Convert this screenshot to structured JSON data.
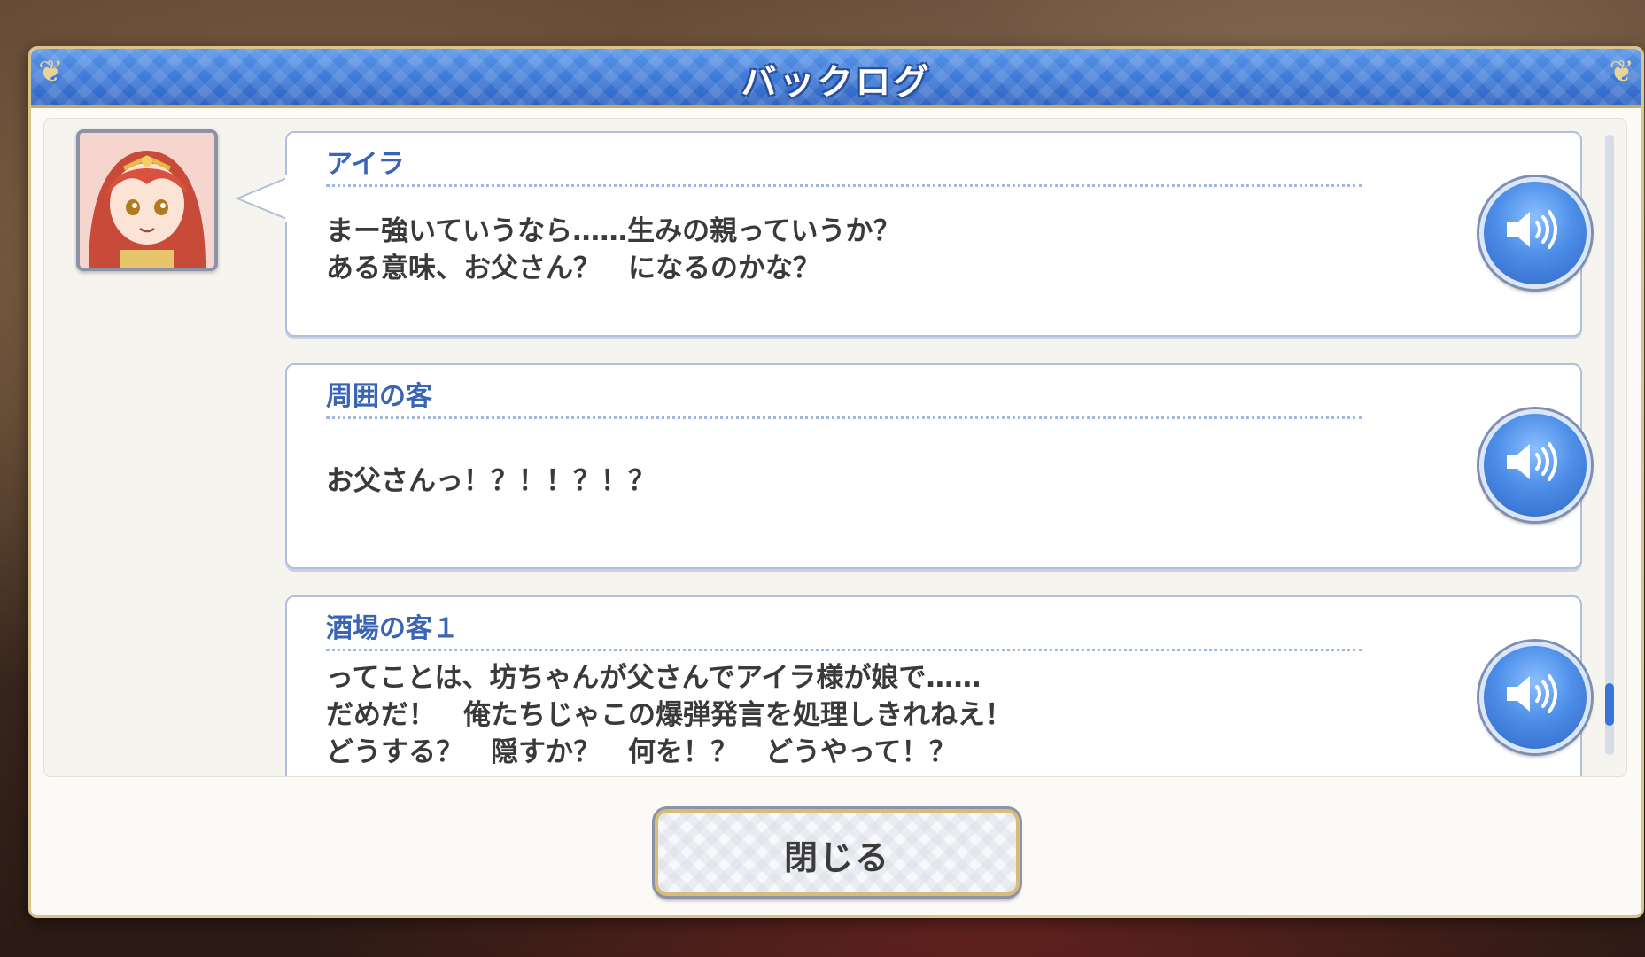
{
  "window": {
    "title": "バックログ"
  },
  "log": {
    "entries": [
      {
        "speaker": "アイラ",
        "text": "まー強いていうなら……生みの親っていうか？\nある意味、お父さん？　になるのかな？",
        "has_portrait": true
      },
      {
        "speaker": "周囲の客",
        "text": "お父さんっ！？！！？！？",
        "has_portrait": false
      },
      {
        "speaker": "酒場の客１",
        "text": "ってことは、坊ちゃんが父さんでアイラ様が娘で……\nだめだ！　俺たちじゃこの爆弾発言を処理しきれねえ！\nどうする？　隠すか？　何を！？　どうやって！？",
        "has_portrait": false
      }
    ],
    "voice_icon": "speaker-volume-icon",
    "scroll_position": 0.95
  },
  "footer": {
    "close_label": "閉じる"
  },
  "colors": {
    "accent_blue": "#3d78d6",
    "speaker_name": "#3a64b5",
    "gold_border": "#d9c48c"
  }
}
